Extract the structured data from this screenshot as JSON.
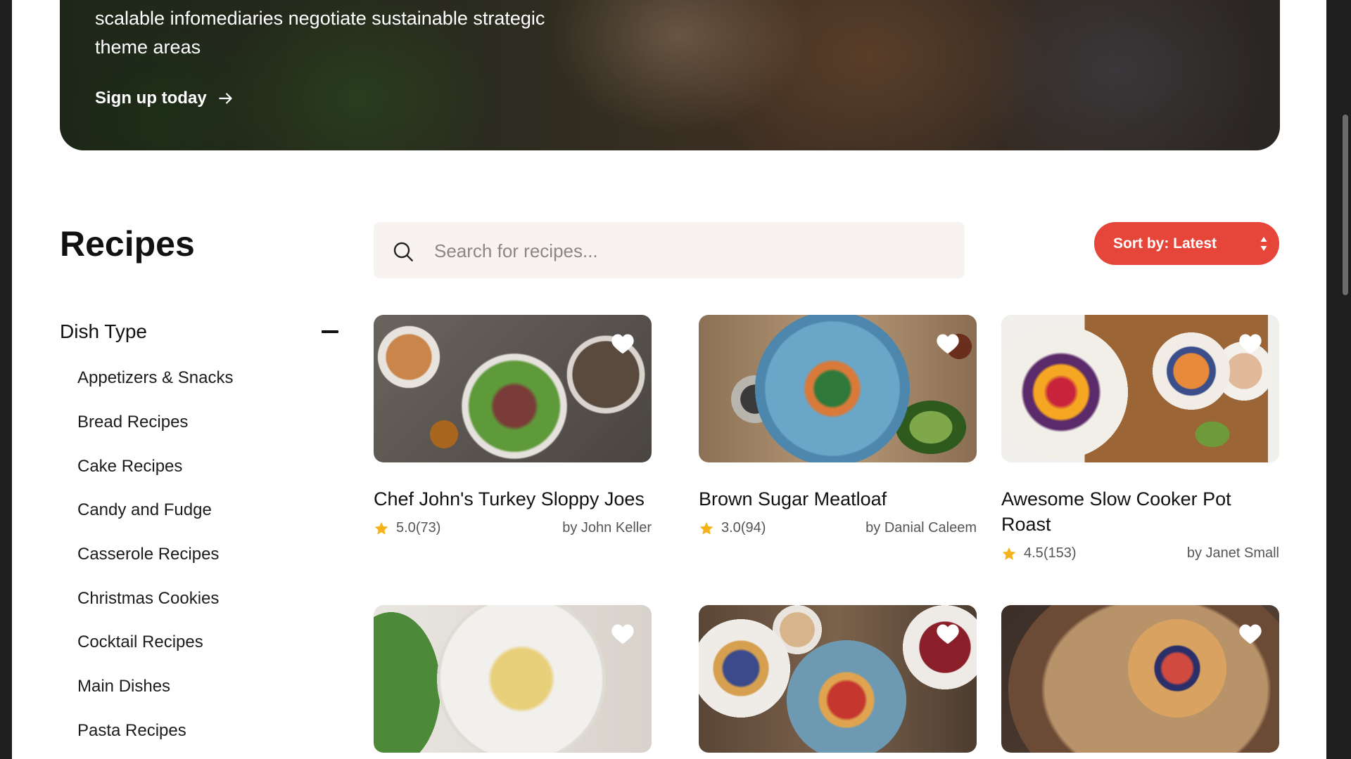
{
  "hero": {
    "text_line1": "scalable infomediaries negotiate sustainable strategic",
    "text_line2": "theme areas",
    "cta_label": "Sign up today"
  },
  "section": {
    "title": "Recipes"
  },
  "search": {
    "placeholder": "Search for recipes..."
  },
  "sort": {
    "label": "Sort by: Latest"
  },
  "sidebar": {
    "facet_label": "Dish Type",
    "items": [
      "Appetizers & Snacks",
      "Bread Recipes",
      "Cake Recipes",
      "Candy and Fudge",
      "Casserole Recipes",
      "Christmas Cookies",
      "Cocktail Recipes",
      "Main Dishes",
      "Pasta Recipes"
    ]
  },
  "recipes": [
    {
      "title": "Chef John's Turkey Sloppy Joes",
      "rating": "5.0",
      "reviews": "(73)",
      "author": "by John Keller"
    },
    {
      "title": "Brown Sugar Meatloaf",
      "rating": "3.0",
      "reviews": "(94)",
      "author": "by Danial Caleem"
    },
    {
      "title": "Awesome Slow Cooker Pot Roast",
      "rating": "4.5",
      "reviews": "(153)",
      "author": "by Janet Small"
    }
  ],
  "colors": {
    "accent": "#e6453a",
    "star": "#f5b21b",
    "search_bg": "#f8f2f0"
  },
  "icons": {
    "search": "search-icon",
    "arrow": "arrow-right-icon",
    "sort": "sort-arrows-icon",
    "collapse": "minus-icon",
    "favorite": "heart-icon",
    "rating": "star-icon"
  }
}
